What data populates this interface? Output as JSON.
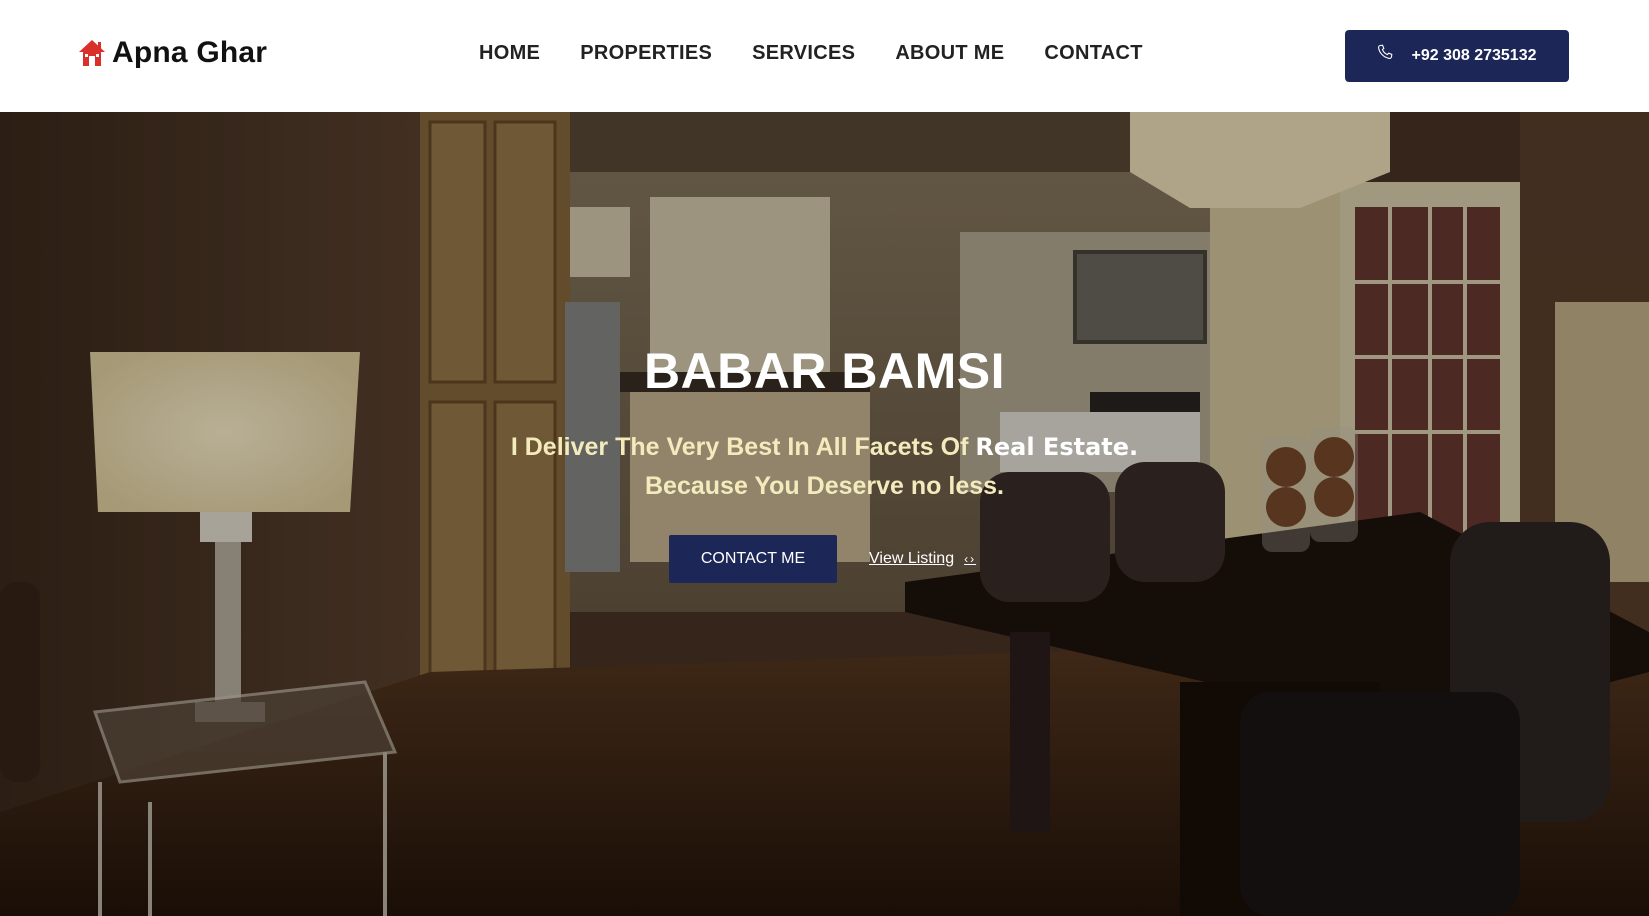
{
  "brand": {
    "name": "Apna Ghar",
    "icon": "house-icon",
    "icon_color": "#d9302c"
  },
  "nav": {
    "items": [
      {
        "label": "HOME"
      },
      {
        "label": "PROPERTIES"
      },
      {
        "label": "SERVICES"
      },
      {
        "label": "ABOUT ME"
      },
      {
        "label": "CONTACT"
      }
    ]
  },
  "header_cta": {
    "phone": "+92 308 2735132",
    "icon": "phone-icon",
    "bg_color": "#1c2657"
  },
  "hero": {
    "title": "BABAR BAMSI",
    "subtitle_part1": "I Deliver The Very Best In All Facets Of",
    "subtitle_strong": "Real Estate.",
    "subtitle_line2": "Because You Deserve no less.",
    "primary_button": "CONTACT ME",
    "secondary_link": "View Listing",
    "secondary_icon": "code-arrows-icon",
    "background": "interior-dining-kitchen-photo"
  },
  "colors": {
    "accent_navy": "#1c2657",
    "subtitle_cream": "#f4ebbd"
  }
}
